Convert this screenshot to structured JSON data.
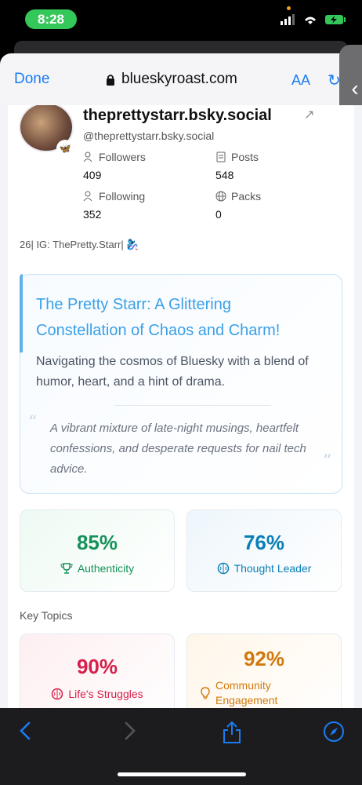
{
  "status": {
    "time": "8:28"
  },
  "browser": {
    "done_label": "Done",
    "url": "blueskyroast.com",
    "aa_label": "AA"
  },
  "profile": {
    "display_name": "theprettystarr.bsky.social",
    "handle": "@theprettystarr.bsky.social",
    "stats": {
      "followers_label": "Followers",
      "followers": "409",
      "posts_label": "Posts",
      "posts": "548",
      "following_label": "Following",
      "following": "352",
      "packs_label": "Packs",
      "packs": "0"
    },
    "bio": "26| IG: ThePretty.Starr| 🧞‍♀️"
  },
  "roast": {
    "title": "The Pretty Starr: A Glittering Constellation of Chaos and Charm!",
    "description": "Navigating the cosmos of Bluesky with a blend of humor, heart, and a hint of drama.",
    "quote": "A vibrant mixture of late-night musings, heartfelt confessions, and desperate requests for nail tech advice."
  },
  "metrics": [
    {
      "value": "85%",
      "label": "Authenticity",
      "color": "#16915a"
    },
    {
      "value": "76%",
      "label": "Thought Leader",
      "color": "#0a7fb4"
    }
  ],
  "key_topics_label": "Key Topics",
  "topics": [
    {
      "value": "90%",
      "label": "Life's Struggles",
      "color": "#d61f4a"
    },
    {
      "value": "92%",
      "label": "Community Engagement",
      "color": "#d07a0c"
    }
  ],
  "colors": {
    "accent": "#1a7cf2",
    "roast_title": "#3aa0e6"
  }
}
